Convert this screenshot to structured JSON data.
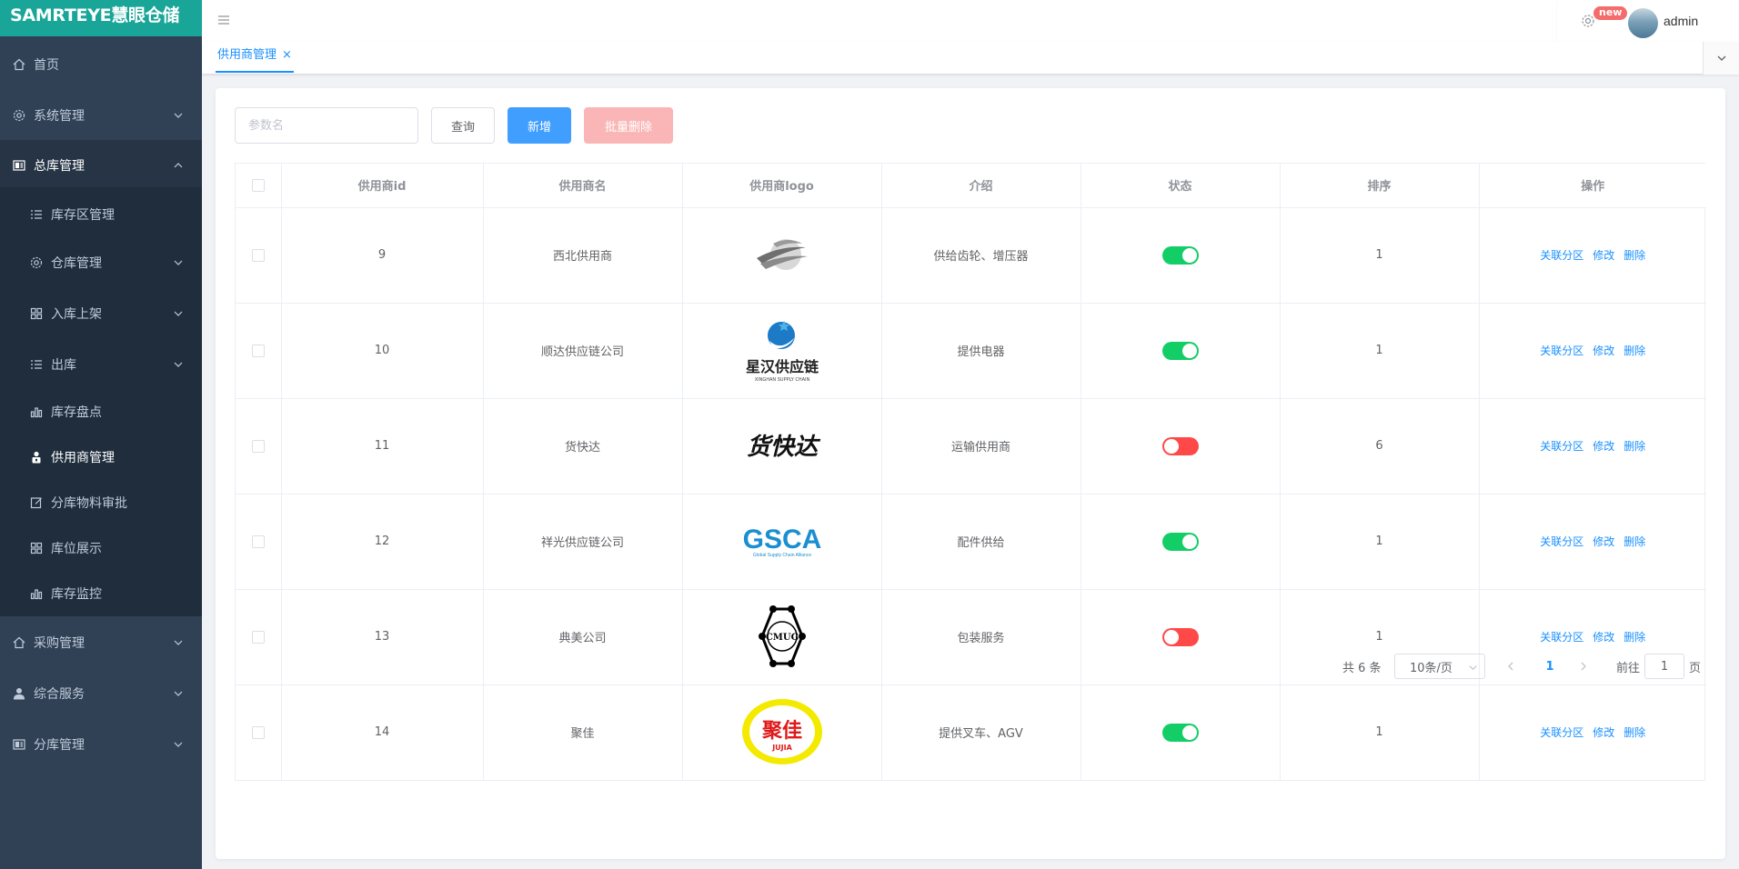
{
  "app": {
    "title": "SAMRTEYE慧眼仓储"
  },
  "sidebar": {
    "items": [
      {
        "label": "首页",
        "icon": "home-icon"
      },
      {
        "label": "系统管理",
        "icon": "gear-icon"
      },
      {
        "label": "总库管理",
        "icon": "dashboard-icon"
      },
      {
        "label": "库存区管理",
        "icon": "list-icon"
      },
      {
        "label": "仓库管理",
        "icon": "gear-icon"
      },
      {
        "label": "入库上架",
        "icon": "grid-icon"
      },
      {
        "label": "出库",
        "icon": "list-icon"
      },
      {
        "label": "库存盘点",
        "icon": "bar-chart-icon"
      },
      {
        "label": "供用商管理",
        "icon": "user-lock-icon"
      },
      {
        "label": "分库物料审批",
        "icon": "edit-icon"
      },
      {
        "label": "库位展示",
        "icon": "grid-icon"
      },
      {
        "label": "库存监控",
        "icon": "bar-chart-icon"
      },
      {
        "label": "采购管理",
        "icon": "home-icon"
      },
      {
        "label": "综合服务",
        "icon": "user-icon"
      },
      {
        "label": "分库管理",
        "icon": "dashboard-icon"
      }
    ]
  },
  "header": {
    "badge": "new",
    "username": "admin"
  },
  "tags": {
    "active_label": "供用商管理",
    "close": "×"
  },
  "toolbar": {
    "search_placeholder": "参数名",
    "query_label": "查询",
    "add_label": "新增",
    "batch_delete_label": "批量删除"
  },
  "table": {
    "headers": [
      "供用商id",
      "供用商名",
      "供用商logo",
      "介绍",
      "状态",
      "排序",
      "操作"
    ],
    "actions": {
      "link": "关联分区",
      "edit": "修改",
      "delete": "删除"
    },
    "rows": [
      {
        "id": "9",
        "name": "西北供用商",
        "logo": "swoosh-logo",
        "intro": "供给齿轮、增压器",
        "status": true,
        "sort": "1"
      },
      {
        "id": "10",
        "name": "顺达供应链公司",
        "logo": "xinghan-logo",
        "logo_text": "星汉供应链",
        "logo_sub": "XINGHAN SUPPLY CHAIN",
        "intro": "提供电器",
        "status": true,
        "sort": "1"
      },
      {
        "id": "11",
        "name": "货快达",
        "logo": "huokuaida-logo",
        "logo_text": "货快达",
        "intro": "运输供用商",
        "status": false,
        "sort": "6"
      },
      {
        "id": "12",
        "name": "祥光供应链公司",
        "logo": "gsca-logo",
        "logo_text": "GSCA",
        "logo_sub": "Global Supply Chain Alliance",
        "intro": "配件供给",
        "status": true,
        "sort": "1"
      },
      {
        "id": "13",
        "name": "典美公司",
        "logo": "cmug-logo",
        "logo_text": "CMUG",
        "intro": "包装服务",
        "status": false,
        "sort": "1"
      },
      {
        "id": "14",
        "name": "聚佳",
        "logo": "jujia-logo",
        "logo_text": "聚佳",
        "logo_sub": "JUJIA",
        "intro": "提供叉车、AGV",
        "status": true,
        "sort": "1"
      }
    ]
  },
  "pagination": {
    "total": "共 6 条",
    "page_size": "10条/页",
    "current": "1",
    "goto_prefix": "前往",
    "goto_value": "1",
    "goto_suffix": "页"
  },
  "colors": {
    "sidebar_bg": "#304156",
    "logo_bg": "#19a597",
    "primary": "#409eff",
    "link": "#1890ff",
    "switch_on": "#13ce66",
    "switch_off": "#ff4949",
    "danger_disabled": "#fab6b6"
  }
}
